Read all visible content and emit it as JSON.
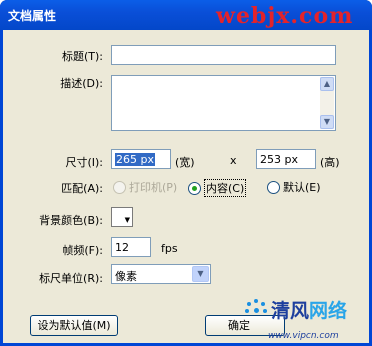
{
  "window": {
    "title": "文档属性",
    "watermark": "webjx.com"
  },
  "form": {
    "title_label": "标题(T):",
    "title_value": "",
    "desc_label": "描述(D):",
    "desc_value": "",
    "size_label": "尺寸(I):",
    "width_value": "265 px",
    "width_unit": "(宽)",
    "times": "x",
    "height_value": "253 px",
    "height_unit": "(高)",
    "match_label": "匹配(A):",
    "match_options": [
      {
        "label": "打印机(P)",
        "checked": false,
        "disabled": true
      },
      {
        "label": "内容(C)",
        "checked": true,
        "disabled": false
      },
      {
        "label": "默认(E)",
        "checked": false,
        "disabled": false
      }
    ],
    "bg_label": "背景颜色(B):",
    "bg_color": "#ffffff",
    "fps_label": "帧频(F):",
    "fps_value": "12",
    "fps_unit": "fps",
    "ruler_label": "标尺单位(R):",
    "ruler_value": "像素"
  },
  "buttons": {
    "default_label": "设为默认值(M)",
    "ok_label": "确定"
  },
  "brand": {
    "name_part1": "清风",
    "name_part2": "网络",
    "url": "www.vipcn.com"
  }
}
